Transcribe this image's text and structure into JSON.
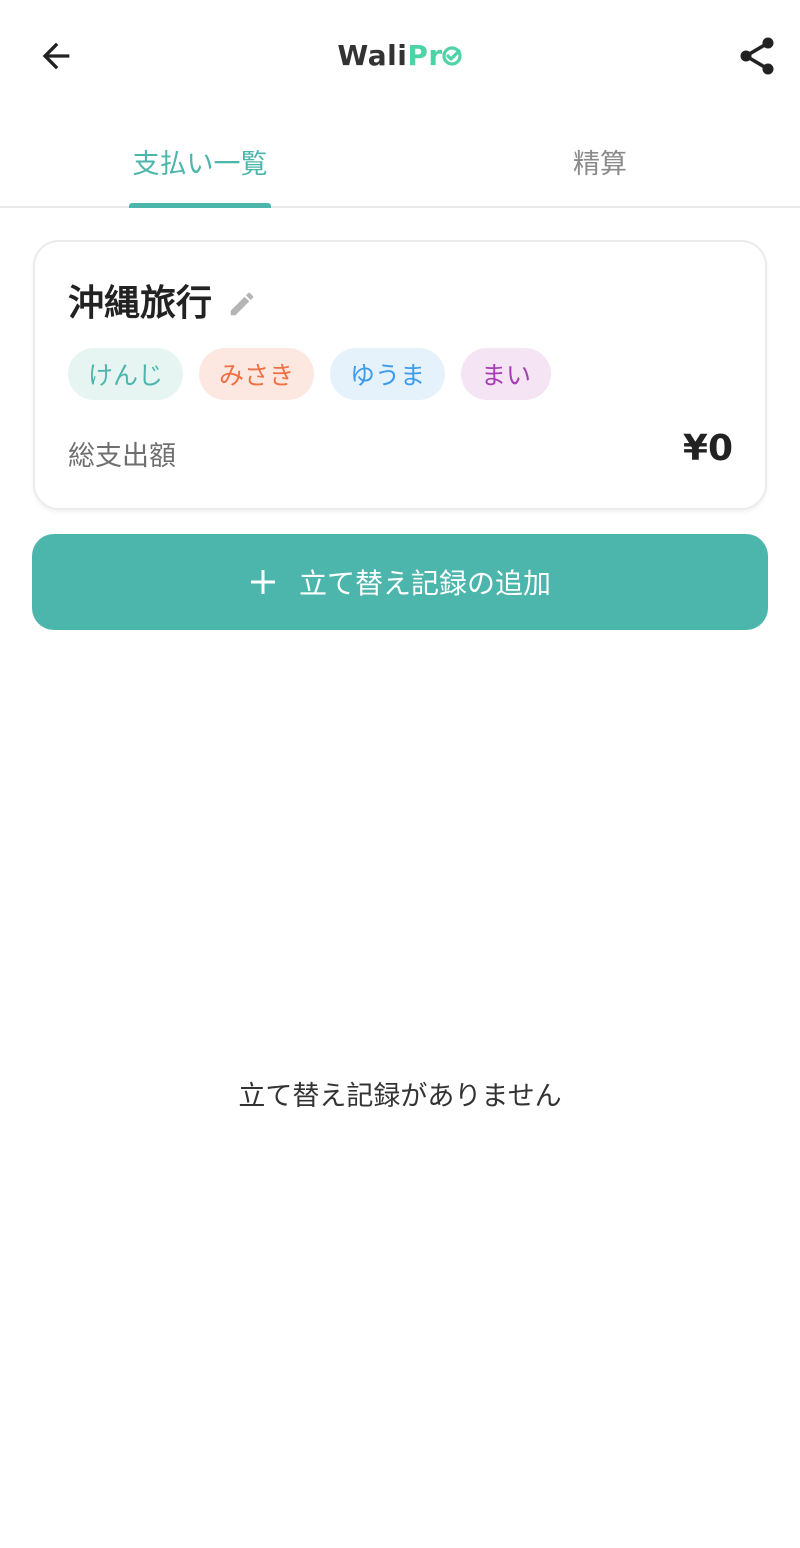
{
  "header": {
    "back_icon": "arrow-left-icon",
    "logo_part1": "Wali",
    "logo_part2": "Pr",
    "share_icon": "share-icon",
    "logo_colors": {
      "dark": "#333333",
      "accent": "#4cd4a6"
    }
  },
  "tabs": [
    {
      "label": "支払い一覧",
      "active": true
    },
    {
      "label": "精算",
      "active": false
    }
  ],
  "accent_color": "#4db6ac",
  "trip": {
    "title": "沖縄旅行",
    "edit_icon": "pencil-icon",
    "members": [
      {
        "name": "けんじ",
        "bg": "#e6f4f2",
        "fg": "#4db6ac"
      },
      {
        "name": "みさき",
        "bg": "#fde8e1",
        "fg": "#f06f43"
      },
      {
        "name": "ゆうま",
        "bg": "#e5f2fc",
        "fg": "#3d9be9"
      },
      {
        "name": "まい",
        "bg": "#f5e4f4",
        "fg": "#a63db5"
      }
    ],
    "total_label": "総支出額",
    "total_amount": "¥0"
  },
  "add_button": {
    "icon": "plus-icon",
    "label": "立て替え記録の追加"
  },
  "empty_message": "立て替え記録がありません"
}
